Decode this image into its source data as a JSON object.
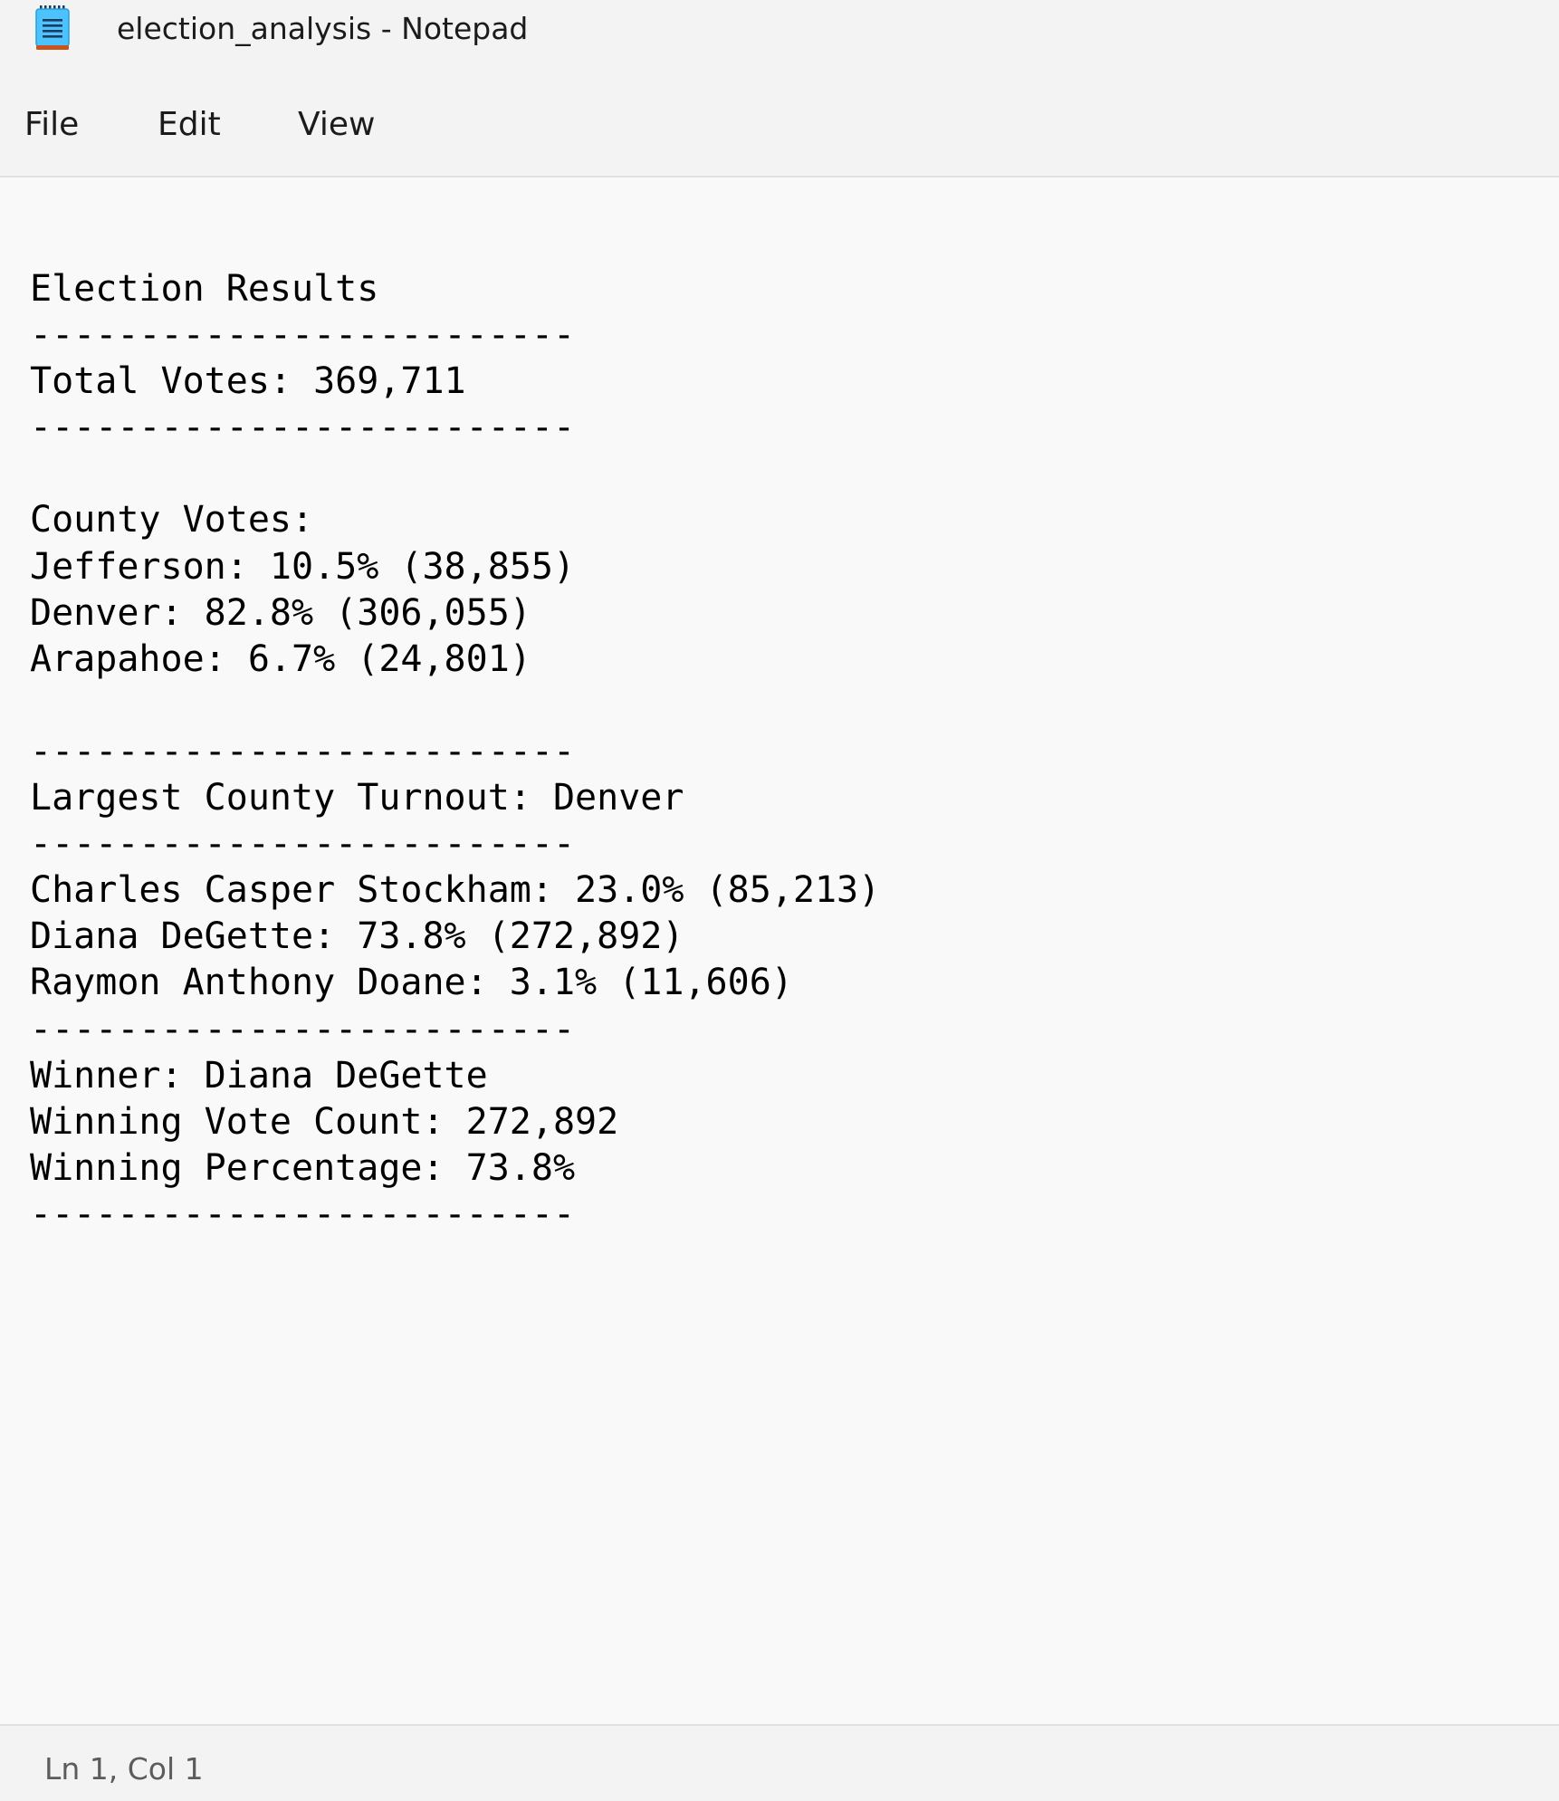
{
  "window": {
    "title": "election_analysis - Notepad",
    "icon": "notepad-icon",
    "accent_color": "#4cc2ff"
  },
  "menu": {
    "items": [
      {
        "label": "File"
      },
      {
        "label": "Edit"
      },
      {
        "label": "View"
      }
    ]
  },
  "document": {
    "lines": [
      "Election Results",
      "-------------------------",
      "Total Votes: 369,711",
      "-------------------------",
      "",
      "County Votes:",
      "Jefferson: 10.5% (38,855)",
      "Denver: 82.8% (306,055)",
      "Arapahoe: 6.7% (24,801)",
      "",
      "-------------------------",
      "Largest County Turnout: Denver",
      "-------------------------",
      "Charles Casper Stockham: 23.0% (85,213)",
      "Diana DeGette: 73.8% (272,892)",
      "Raymon Anthony Doane: 3.1% (11,606)",
      "-------------------------",
      "Winner: Diana DeGette",
      "Winning Vote Count: 272,892",
      "Winning Percentage: 73.8%",
      "-------------------------"
    ]
  },
  "status_bar": {
    "cursor_position": "Ln 1, Col 1"
  }
}
